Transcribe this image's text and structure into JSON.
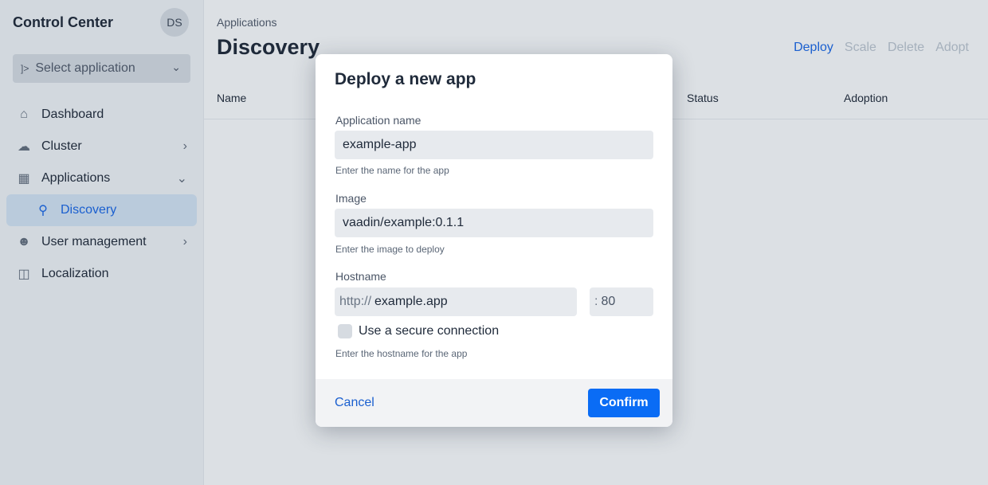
{
  "sidebar": {
    "brand": "Control Center",
    "avatar": "DS",
    "select_app": {
      "icon": "terminal-icon",
      "label": "Select application"
    },
    "items": [
      {
        "label": "Dashboard"
      },
      {
        "label": "Cluster"
      },
      {
        "label": "Applications"
      },
      {
        "label": "Discovery"
      },
      {
        "label": "User management"
      },
      {
        "label": "Localization"
      }
    ]
  },
  "main": {
    "breadcrumb": "Applications",
    "title": "Discovery",
    "actions": [
      "Deploy",
      "Scale",
      "Delete",
      "Adopt"
    ],
    "columns": [
      "Name",
      "Status",
      "Adoption"
    ]
  },
  "dialog": {
    "title": "Deploy a new app",
    "app_name": {
      "label": "Application name",
      "value": "example-app",
      "help": "Enter the name for the app"
    },
    "image": {
      "label": "Image",
      "value": "vaadin/example:0.1.1",
      "help": "Enter the image to deploy"
    },
    "hostname": {
      "label": "Hostname",
      "prefix": "http://",
      "value": "example.app",
      "port_prefix": ":",
      "port": "80",
      "secure_label": "Use a secure connection",
      "help": "Enter the hostname for the app"
    },
    "cancel": "Cancel",
    "confirm": "Confirm"
  },
  "colors": {
    "accent": "#0a6cf5",
    "link": "#1a5fcf"
  }
}
